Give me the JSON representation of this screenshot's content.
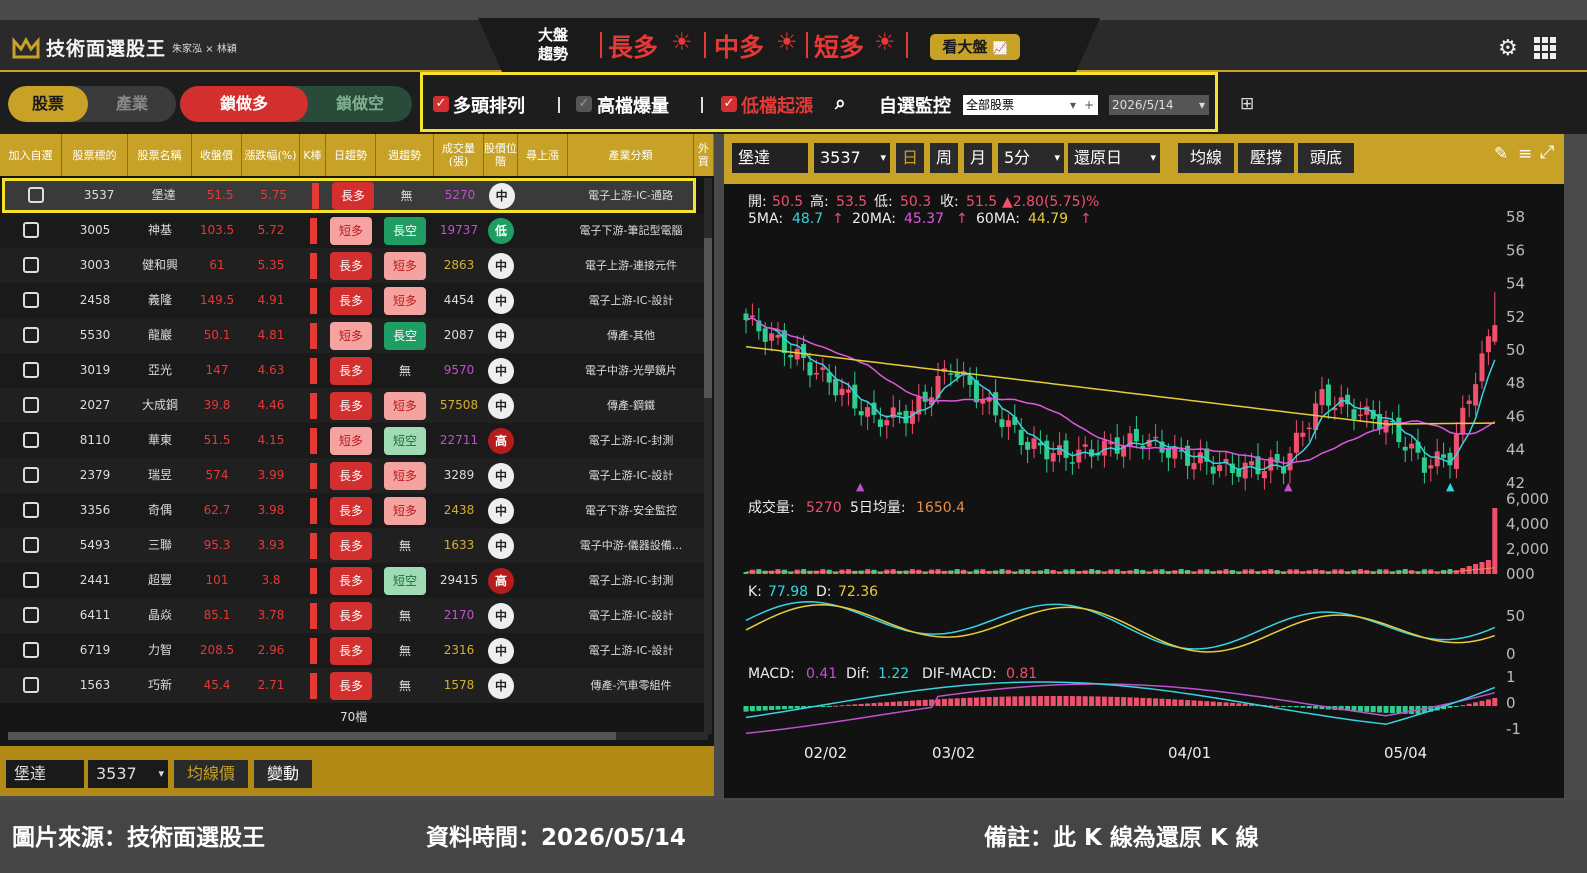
{
  "header": {
    "title": "技術面選股王",
    "authors": "朱家泓 × 林穎",
    "trend_label_1": "大盤",
    "trend_label_2": "趨勢",
    "long": "長多",
    "mid": "中多",
    "short": "短多",
    "view_market": "看大盤"
  },
  "toolbar": {
    "tab_stock": "股票",
    "tab_industry": "產業",
    "lock_long": "鎖做多",
    "lock_short": "鎖做空",
    "f1": "多頭排列",
    "f2": "高檔爆量",
    "f3": "低檔起漲",
    "f4": "自選監控",
    "watch_select": "全部股票",
    "date": "2026/5/14"
  },
  "table": {
    "headers": [
      "加入自選",
      "股票標的",
      "股票名稱",
      "收盤價",
      "漲跌幅(%)",
      "K棒",
      "日趨勢",
      "週趨勢",
      "成交量(張)",
      "股價位階",
      "尋上漲",
      "產業分類",
      "外買"
    ],
    "rows": [
      [
        "3537",
        "堡達",
        "51.5",
        "5.75",
        "長多",
        "無",
        "5270",
        "中",
        "電子上游-IC-通路"
      ],
      [
        "3005",
        "神基",
        "103.5",
        "5.72",
        "短多",
        "長空",
        "19737",
        "低",
        "電子下游-筆記型電腦"
      ],
      [
        "3003",
        "健和興",
        "61",
        "5.35",
        "長多",
        "短多",
        "2863",
        "中",
        "電子上游-連接元件"
      ],
      [
        "2458",
        "義隆",
        "149.5",
        "4.91",
        "長多",
        "短多",
        "4454",
        "中",
        "電子上游-IC-設計"
      ],
      [
        "5530",
        "龍巖",
        "50.1",
        "4.81",
        "短多",
        "長空",
        "2087",
        "中",
        "傳產-其他"
      ],
      [
        "3019",
        "亞光",
        "147",
        "4.63",
        "長多",
        "無",
        "9570",
        "中",
        "電子中游-光學鏡片"
      ],
      [
        "2027",
        "大成鋼",
        "39.8",
        "4.46",
        "長多",
        "短多",
        "57508",
        "中",
        "傳產-鋼鐵"
      ],
      [
        "8110",
        "華東",
        "51.5",
        "4.15",
        "短多",
        "短空",
        "22711",
        "高",
        "電子上游-IC-封測"
      ],
      [
        "2379",
        "瑞昱",
        "574",
        "3.99",
        "長多",
        "短多",
        "3289",
        "中",
        "電子上游-IC-設計"
      ],
      [
        "3356",
        "奇偶",
        "62.7",
        "3.98",
        "長多",
        "短多",
        "2438",
        "中",
        "電子下游-安全監控"
      ],
      [
        "5493",
        "三聯",
        "95.3",
        "3.93",
        "長多",
        "無",
        "1633",
        "中",
        "電子中游-儀器設備..."
      ],
      [
        "2441",
        "超豐",
        "101",
        "3.8",
        "長多",
        "短空",
        "29415",
        "高",
        "電子上游-IC-封測"
      ],
      [
        "6411",
        "晶焱",
        "85.1",
        "3.78",
        "長多",
        "無",
        "2170",
        "中",
        "電子上游-IC-設計"
      ],
      [
        "6719",
        "力智",
        "208.5",
        "2.96",
        "長多",
        "無",
        "2316",
        "中",
        "電子上游-IC-設計"
      ],
      [
        "1563",
        "巧新",
        "45.4",
        "2.71",
        "長多",
        "無",
        "1578",
        "中",
        "傳產-汽車零組件"
      ]
    ],
    "count": "70檔"
  },
  "table_footer": {
    "name": "堡達",
    "code": "3537",
    "ma_price": "均線價",
    "change": "變動"
  },
  "chart_toolbar": {
    "name": "堡達",
    "code": "3537",
    "day": "日",
    "week": "周",
    "month": "月",
    "min5": "5分",
    "restore": "還原日",
    "ma": "均線",
    "pressure": "壓撐",
    "top_bottom": "頭底"
  },
  "chart_data": {
    "type": "candlestick",
    "ohlc_label": "開: 50.5 高: 53.5 低: 50.3 收: 51.5▲2.80(5.75)%",
    "open": "50.5",
    "high": "53.5",
    "low": "50.3",
    "close": "51.5",
    "change": "▲2.80(5.75)%",
    "ma5": "48.7",
    "ma20": "45.37",
    "ma60": "44.79",
    "price_ticks": [
      "58",
      "56",
      "54",
      "52",
      "50",
      "48",
      "46",
      "44",
      "42"
    ],
    "volume": "5270",
    "vol5": "1650.4",
    "vol_ticks": [
      "6,000",
      "4,000",
      "2,000",
      "000"
    ],
    "k": "77.98",
    "d": "72.36",
    "kd_ticks": [
      "50",
      "0"
    ],
    "macd": "0.41",
    "dif": "1.22",
    "dif_macd": "0.81",
    "macd_ticks": [
      "1",
      "0",
      "-1"
    ],
    "x_labels": [
      "02/02",
      "03/02",
      "04/01",
      "05/04"
    ],
    "colors": {
      "up": "#f0506e",
      "down": "#2ecc8f",
      "ma5": "#35d4e0",
      "ma20": "#e056e0",
      "ma60": "#e8cc3a"
    }
  },
  "footer": {
    "source": "圖片來源：技術面選股王",
    "time": "資料時間：2026/05/14",
    "note": "備註：此 K 線為還原 K 線"
  }
}
